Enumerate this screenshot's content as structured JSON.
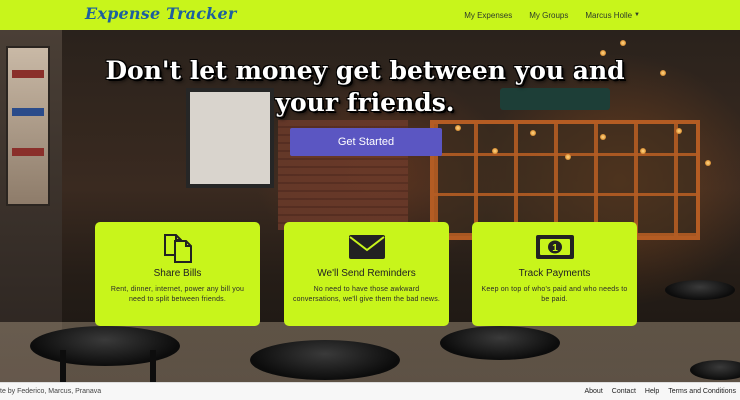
{
  "navbar": {
    "brand": "Expense Tracker",
    "links": [
      "My Expenses",
      "My Groups"
    ],
    "user": "Marcus Holle"
  },
  "hero": {
    "headline": "Don't let money get between you and your friends.",
    "cta_label": "Get Started"
  },
  "features": [
    {
      "icon": "documents-icon",
      "title": "Share Bills",
      "desc": "Rent, dinner, internet, power any bill you need to split between friends."
    },
    {
      "icon": "envelope-icon",
      "title": "We'll Send Reminders",
      "desc": "No need to have those awkward conversations, we'll give them the bad news."
    },
    {
      "icon": "money-bill-icon",
      "title": "Track Payments",
      "desc": "Keep on top of who's paid and who needs to be paid."
    }
  ],
  "footer": {
    "credit": "te by Federico, Marcus, Pranava",
    "links": [
      "About",
      "Contact",
      "Help",
      "Terms and Conditions"
    ]
  },
  "colors": {
    "accent": "#c8f51b",
    "cta": "#5b56c2",
    "brand_text": "#1d5f9e"
  }
}
